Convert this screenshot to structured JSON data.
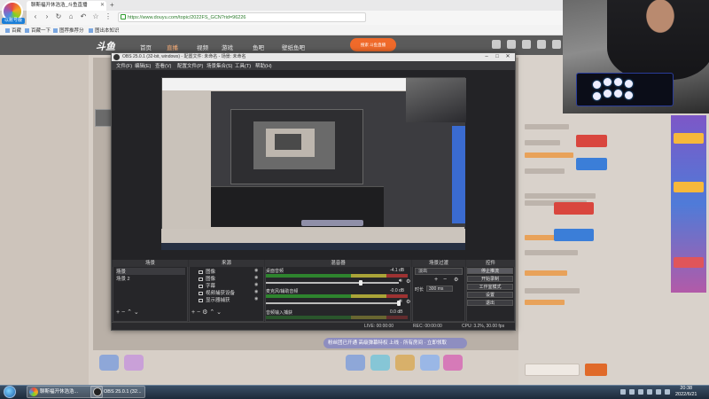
{
  "browser": {
    "logo_label": "以账号版",
    "tab_title": "聊斯福开休浩浩_斗鱼直播",
    "url": "https://www.douyu.com/topic/2022FS_GCN?rid=96226",
    "bookmarks": [
      "百藏",
      "百藏一下",
      "图荐推荐分",
      "图出本知识"
    ]
  },
  "site": {
    "brand": "斗鱼",
    "nav": [
      "首页",
      "直播",
      "视频",
      "游戏",
      "鱼吧",
      "壁纸鱼吧"
    ],
    "search_label": "搜索 斗鱼直播"
  },
  "obs": {
    "title": "OBS 25.0.1 (32-bit, windows) - 配置文件: 未命名 - 场景: 未命名",
    "menu": [
      "文件(F)",
      "编辑(E)",
      "查看(V)",
      "配置文件(P)",
      "场景集合(S)",
      "工具(T)",
      "帮助(H)"
    ],
    "docks": {
      "scenes_title": "场景",
      "sources_title": "来源",
      "mixer_title": "混音器",
      "transitions_title": "场景过渡",
      "controls_title": "控件"
    },
    "scenes": [
      "场景",
      "场景 2"
    ],
    "sources": [
      "图像",
      "图像",
      "字幕",
      "视频捕获设备",
      "显示器捕获"
    ],
    "mixer": [
      {
        "label": "桌面音频",
        "db": "-4.1 dB"
      },
      {
        "label": "麦克风/辅助音频",
        "db": "-0.0 dB"
      },
      {
        "label": "音频输入捕获",
        "db": "0.0 dB"
      }
    ],
    "transition": {
      "type": "淡出",
      "duration_label": "时长",
      "duration_value": "300 ms"
    },
    "controls": [
      "停止推流",
      "开始录制",
      "工作室模式",
      "设置",
      "退出"
    ],
    "status": {
      "live": "LIVE: 00:00:00",
      "rec": "REC: 00:00:00",
      "cpu": "CPU: 3.2%, 30.00 fps"
    }
  },
  "page": {
    "danmaku_pill": "粉丝团已开通 高级弹幕特权 上线 · 所有房间 · 立即领取"
  },
  "taskbar": {
    "items": [
      "聊斯福开休浩浩...",
      "OBS 25.0.1 (32..."
    ],
    "time": "20:38",
    "date": "2022/6/21"
  }
}
